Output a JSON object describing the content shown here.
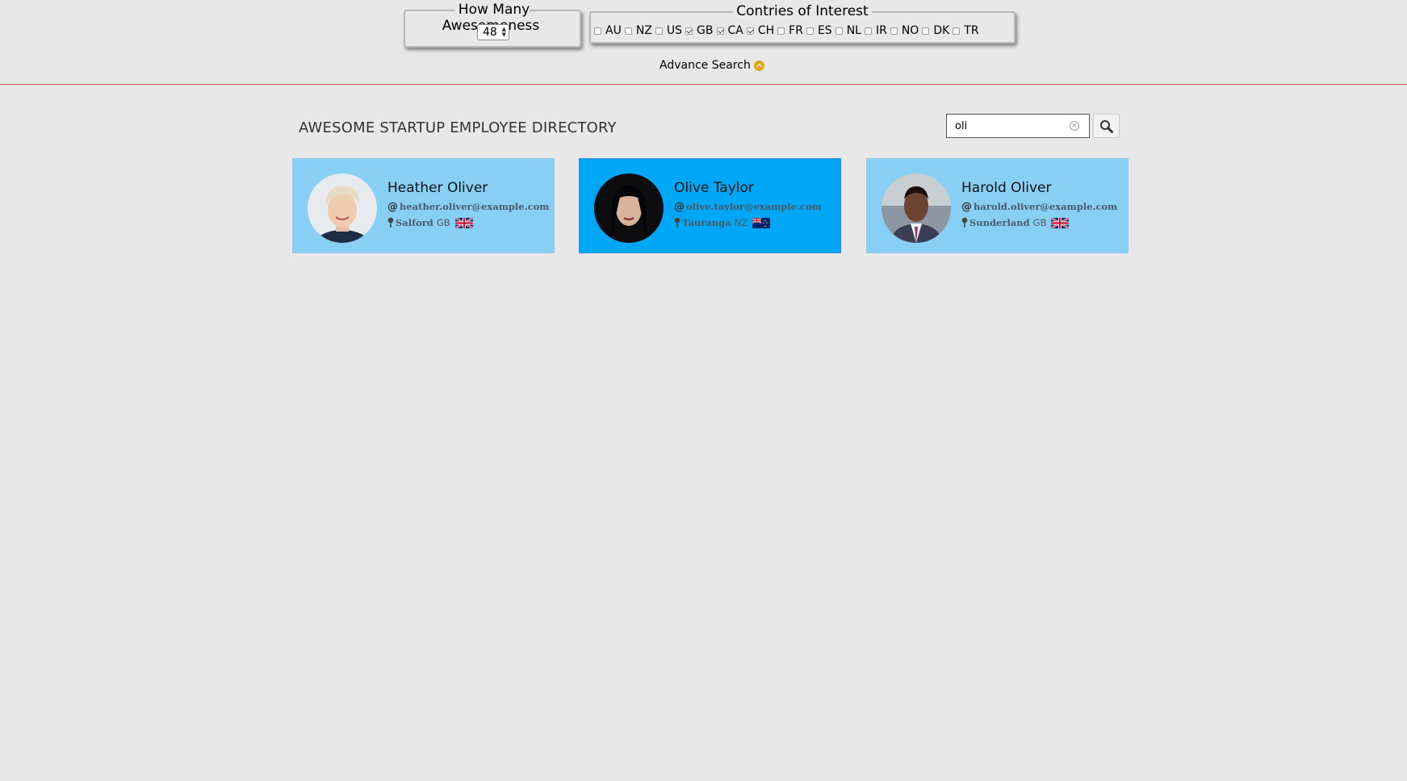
{
  "filters": {
    "awesomeness": {
      "legend": "How Many Awesomeness",
      "value": "48"
    },
    "countries": {
      "legend": "Contries of Interest",
      "items": [
        {
          "code": "AU",
          "checked": false
        },
        {
          "code": "NZ",
          "checked": false
        },
        {
          "code": "US",
          "checked": false
        },
        {
          "code": "GB",
          "checked": true
        },
        {
          "code": "CA",
          "checked": true
        },
        {
          "code": "CH",
          "checked": true
        },
        {
          "code": "FR",
          "checked": false
        },
        {
          "code": "ES",
          "checked": false
        },
        {
          "code": "NL",
          "checked": false
        },
        {
          "code": "IR",
          "checked": false
        },
        {
          "code": "NO",
          "checked": false
        },
        {
          "code": "DK",
          "checked": false
        },
        {
          "code": "TR",
          "checked": false
        }
      ]
    },
    "advance_search_label": "Advance Search"
  },
  "directory": {
    "title": "AWESOME STARTUP EMPLOYEE DIRECTORY"
  },
  "search": {
    "value": "oli",
    "icon": "magnifier-icon"
  },
  "colors": {
    "card_bg": "#87cff4",
    "card_selected_bg": "#00a7f7",
    "divider": "#d65050",
    "accent": "#e0a81d"
  },
  "employees": [
    {
      "name": "Heather Oliver",
      "email": "heather.oliver@example.com",
      "city": "Salford",
      "country": "GB",
      "selected": false
    },
    {
      "name": "Olive Taylor",
      "email": "olive.taylor@example.com",
      "city": "Tauranga",
      "country": "NZ",
      "selected": true
    },
    {
      "name": "Harold Oliver",
      "email": "harold.oliver@example.com",
      "city": "Sunderland",
      "country": "GB",
      "selected": false
    }
  ]
}
